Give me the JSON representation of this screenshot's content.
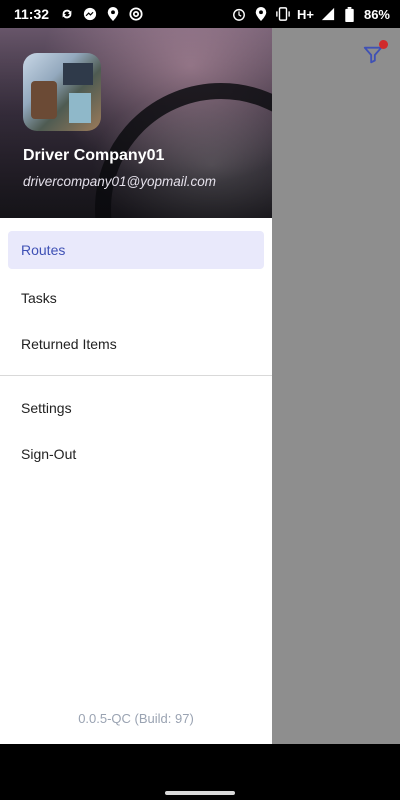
{
  "status_bar": {
    "time": "11:32",
    "network": "H+",
    "battery": "86%"
  },
  "drawer": {
    "user_name": "Driver Company01",
    "user_email": "drivercompany01@yopmail.com",
    "menu": [
      {
        "label": "Routes",
        "active": true
      },
      {
        "label": "Tasks",
        "active": false
      },
      {
        "label": "Returned Items",
        "active": false
      },
      {
        "label": "Settings",
        "active": false
      },
      {
        "label": "Sign-Out",
        "active": false
      }
    ],
    "version": "0.0.5-QC (Build: 97)"
  },
  "colors": {
    "accent": "#3f51b5",
    "active_bg": "#e9e9fb",
    "filter_badge": "#d12b2b"
  }
}
